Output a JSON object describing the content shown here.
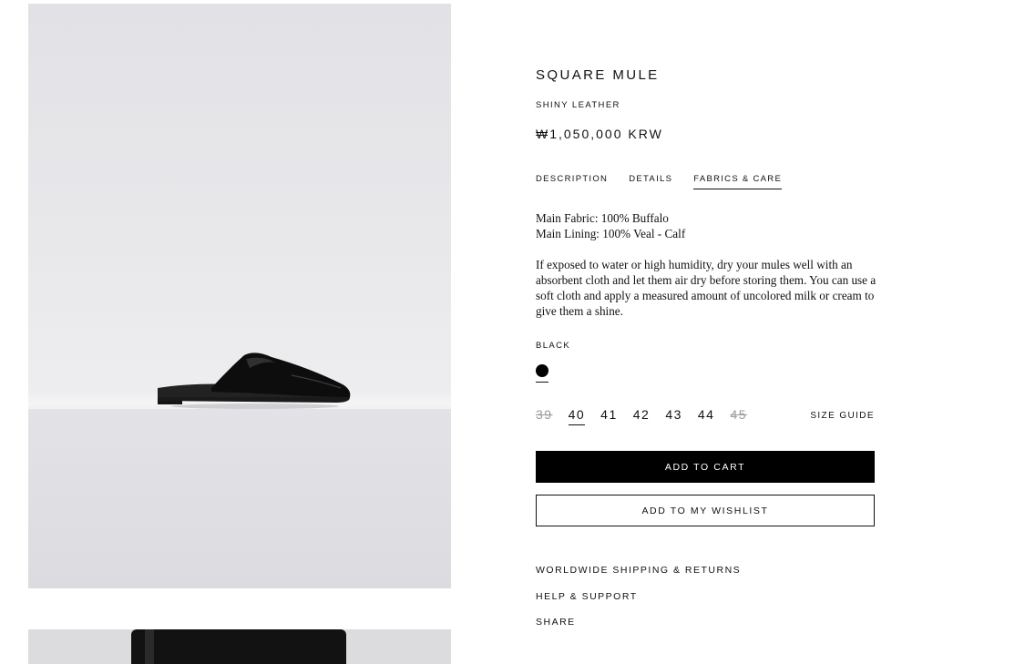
{
  "product": {
    "name": "SQUARE MULE",
    "material": "SHINY LEATHER",
    "price": "₩1,050,000 KRW"
  },
  "tabs": [
    {
      "label": "DESCRIPTION",
      "active": false
    },
    {
      "label": "DETAILS",
      "active": false
    },
    {
      "label": "FABRICS & CARE",
      "active": true
    }
  ],
  "care": {
    "line1": "Main Fabric: 100% Buffalo",
    "line2": "Main Lining: 100% Veal - Calf",
    "instructions": "If exposed to water or high humidity, dry your mules well with an absorbent cloth and let them air dry before storing them. You can use a soft cloth and apply a measured amount of uncolored milk or cream to give them a shine."
  },
  "color": {
    "label": "BLACK",
    "swatch": "#000000"
  },
  "sizes": [
    {
      "label": "39",
      "available": false,
      "selected": false
    },
    {
      "label": "40",
      "available": true,
      "selected": true
    },
    {
      "label": "41",
      "available": true,
      "selected": false
    },
    {
      "label": "42",
      "available": true,
      "selected": false
    },
    {
      "label": "43",
      "available": true,
      "selected": false
    },
    {
      "label": "44",
      "available": true,
      "selected": false
    },
    {
      "label": "45",
      "available": false,
      "selected": false
    }
  ],
  "size_guide_label": "SIZE GUIDE",
  "buttons": {
    "add_to_cart": "ADD TO CART",
    "add_to_wishlist": "ADD TO MY WISHLIST"
  },
  "links": {
    "shipping": "WORLDWIDE SHIPPING & RETURNS",
    "help": "HELP & SUPPORT",
    "share": "SHARE"
  },
  "colors": {
    "text": "#111111",
    "unavailable": "#9a9a9a",
    "primary_button": "#000000",
    "background": "#ffffff"
  }
}
